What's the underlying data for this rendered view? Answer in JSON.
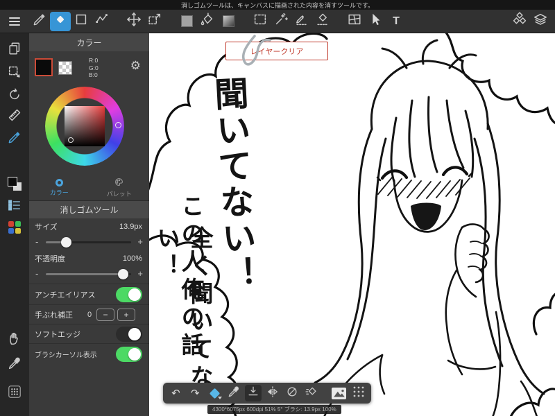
{
  "notification": "消しゴムツールは、キャンバスに描画された内容を消すツールです。",
  "toolbar": {
    "text_tool": "T"
  },
  "icons": {
    "gear": "⚙",
    "undo": "↶",
    "redo": "↷"
  },
  "color_panel": {
    "title": "カラー",
    "rgb_r": "R:0",
    "rgb_g": "G:0",
    "rgb_b": "B:0",
    "tab_color": "カラー",
    "tab_palette": "パレット"
  },
  "eraser_panel": {
    "title": "消しゴムツール",
    "size_label": "サイズ",
    "size_value": "13.9px",
    "opacity_label": "不透明度",
    "opacity_value": "100%",
    "slider_minus": "-",
    "slider_plus": "+",
    "antialias_label": "アンチエイリアス",
    "correction_label": "手ぶれ補正",
    "correction_value": "0",
    "stepper_minus": "−",
    "stepper_plus": "+",
    "softedge_label": "ソフトエッジ",
    "brushcursor_label": "ブラシカーソル表示"
  },
  "canvas": {
    "layer_clear": "レイヤークリア",
    "vtext_main": "聞いてない！",
    "vtext_col1": "この人俺の話",
    "vtext_col2": "全く聞いてない！"
  },
  "footer": {
    "status": "4300*6075px 600dpi 51% 5° ブラシ: 13.9px 100%"
  },
  "colors": {
    "accent": "#3795d6",
    "toggle_on": "#4cd964",
    "alert": "#c0392b",
    "selected_swatch_border": "#cc4b38"
  }
}
